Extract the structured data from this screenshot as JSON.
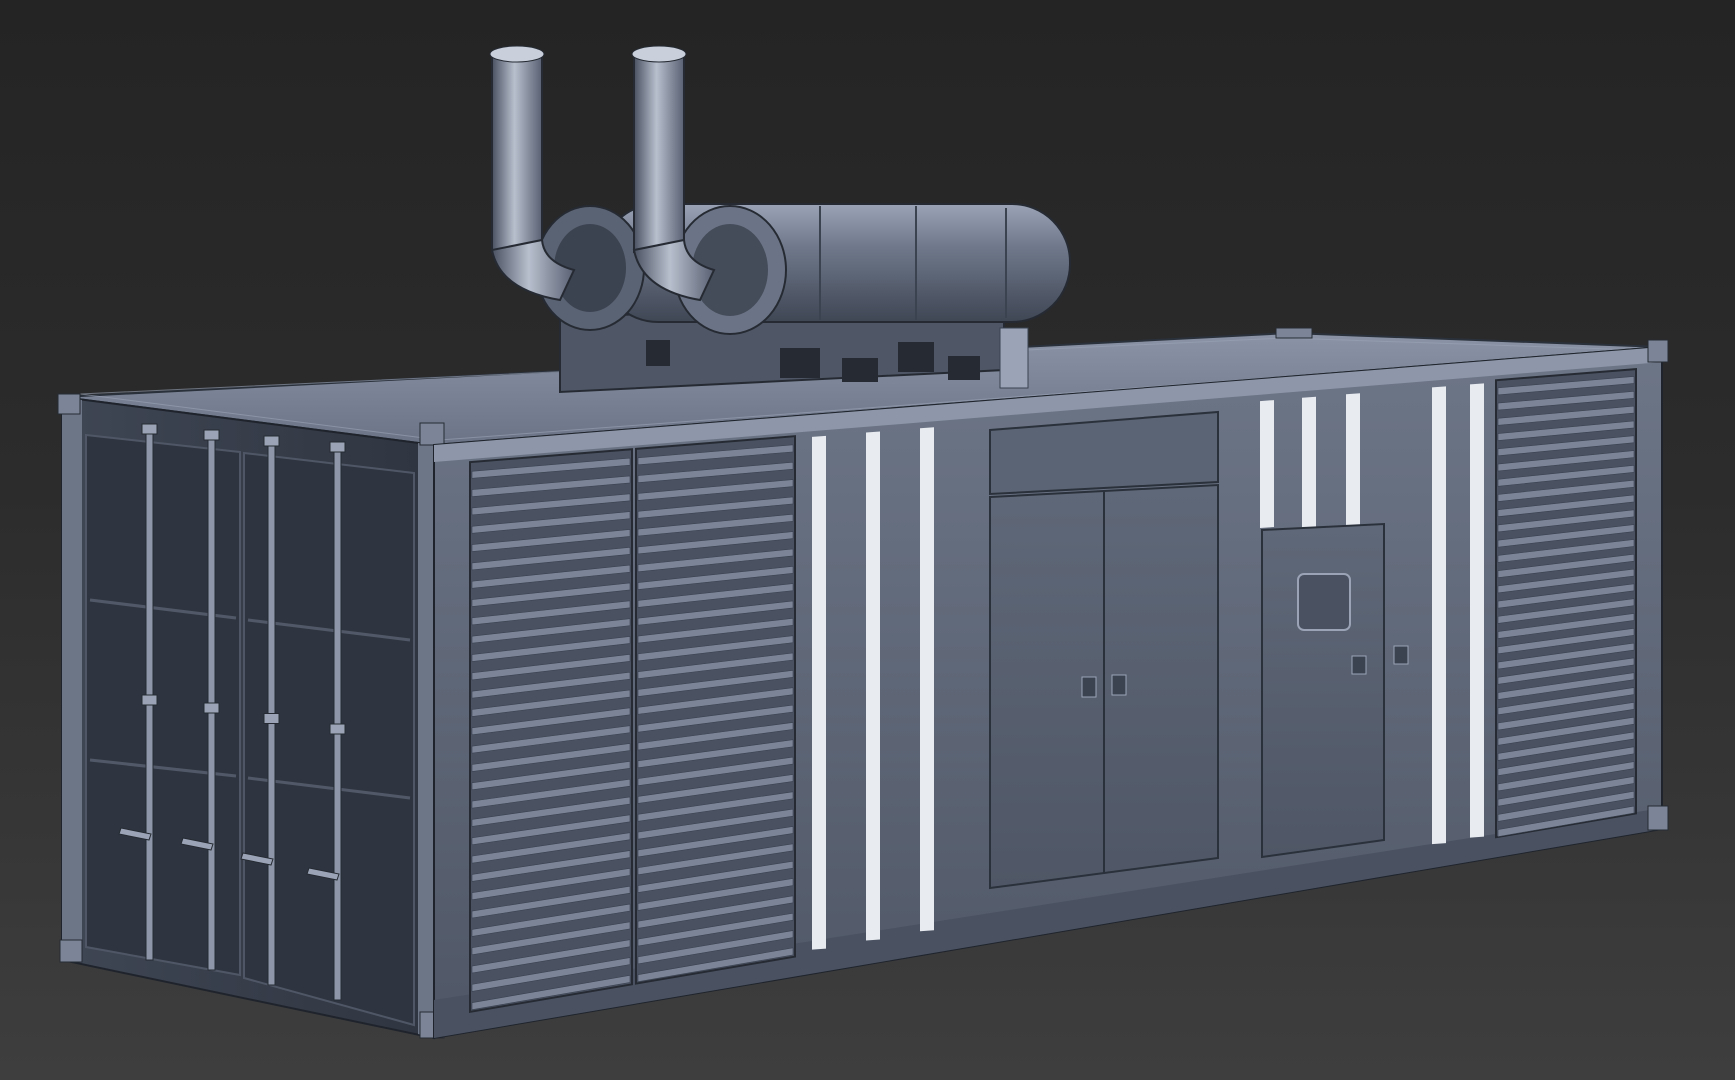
{
  "viewport": {
    "background_top": "#242424",
    "background_bottom": "#3e3e3e"
  },
  "model": {
    "subject": "generator-container",
    "colors": {
      "body": "#5f6878",
      "body_light": "#7b8597",
      "body_dark": "#3b4250",
      "highlight": "#c9d0dc",
      "stripe": "#e8ebf0",
      "shadow": "#262b33"
    },
    "louver_slat_count": 30,
    "exhaust_stacks": 2
  }
}
